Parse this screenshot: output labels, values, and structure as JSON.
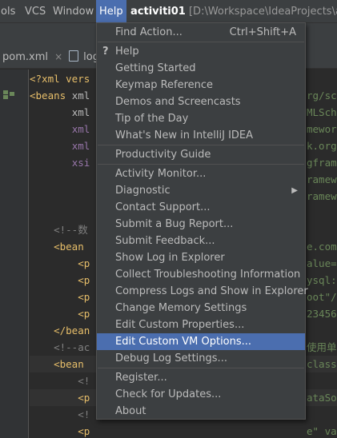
{
  "menubar": {
    "items": [
      {
        "label": "ols"
      },
      {
        "label": "VCS"
      },
      {
        "label": "Window"
      },
      {
        "label": "Help"
      }
    ]
  },
  "titlebar": {
    "project": "activiti01",
    "path": "[D:\\Workspace\\IdeaProjects\\activ"
  },
  "tabs": [
    {
      "label": "pom.xml",
      "close": "×"
    },
    {
      "label": "log"
    }
  ],
  "editor": {
    "lines": [
      {
        "indent": "",
        "parts": [
          [
            "pi",
            "<?xml vers"
          ]
        ]
      },
      {
        "indent": "",
        "parts": [
          [
            "tag",
            "<beans "
          ],
          [
            "attr",
            "xml"
          ]
        ],
        "tail": "rg/sch"
      },
      {
        "indent": "       ",
        "parts": [
          [
            "attr",
            "xml"
          ]
        ],
        "tail": "MLSche"
      },
      {
        "indent": "       ",
        "parts": [
          [
            "attrdim",
            "xml"
          ]
        ],
        "tail": "mework"
      },
      {
        "indent": "       ",
        "parts": [
          [
            "attrdim",
            "xml"
          ]
        ],
        "tail": "k.org/"
      },
      {
        "indent": "       ",
        "parts": [
          [
            "attrdim",
            "xsi"
          ]
        ],
        "tail": "gfram"
      },
      {
        "indent": "",
        "parts": [],
        "tail": "ramewo"
      },
      {
        "indent": "",
        "parts": [],
        "tail": "ramewo"
      },
      {
        "indent": "",
        "parts": []
      },
      {
        "indent": "    ",
        "parts": [
          [
            "cmt",
            "<!--数"
          ]
        ]
      },
      {
        "indent": "    ",
        "parts": [
          [
            "tag",
            "<bean "
          ]
        ],
        "tail": "e.comm"
      },
      {
        "indent": "        ",
        "parts": [
          [
            "tag",
            "<p"
          ]
        ],
        "tail": "alue=\""
      },
      {
        "indent": "        ",
        "parts": [
          [
            "tag",
            "<p"
          ]
        ],
        "tail": "ysql:/"
      },
      {
        "indent": "        ",
        "parts": [
          [
            "tag",
            "<p"
          ]
        ],
        "tail": "oot\"/>"
      },
      {
        "indent": "        ",
        "parts": [
          [
            "tag",
            "<p"
          ]
        ],
        "tail": "23456\""
      },
      {
        "indent": "    ",
        "parts": [
          [
            "tag",
            "</bean"
          ]
        ]
      },
      {
        "indent": "    ",
        "parts": [
          [
            "cmt",
            "<!--ac"
          ]
        ],
        "tail": "使用单"
      },
      {
        "indent": "    ",
        "parts": [
          [
            "tag",
            "<bean "
          ]
        ],
        "tail": "class="
      },
      {
        "indent": "        ",
        "parts": [
          [
            "cmt",
            "<!"
          ]
        ]
      },
      {
        "indent": "        ",
        "parts": [
          [
            "tag",
            "<p"
          ]
        ],
        "tail": "ataSou"
      },
      {
        "indent": "        ",
        "parts": [
          [
            "cmt",
            "<!"
          ]
        ]
      },
      {
        "indent": "        ",
        "parts": [
          [
            "tag",
            "<p"
          ]
        ],
        "tail": "e\" va"
      },
      {
        "indent": "    ",
        "parts": [
          [
            "tag",
            "</bean"
          ]
        ]
      }
    ]
  },
  "help_menu": {
    "items": [
      {
        "label": "Find Action...",
        "shortcut": "Ctrl+Shift+A"
      },
      {
        "sep": true
      },
      {
        "label": "Help",
        "icon": "?"
      },
      {
        "label": "Getting Started"
      },
      {
        "label": "Keymap Reference"
      },
      {
        "label": "Demos and Screencasts"
      },
      {
        "label": "Tip of the Day"
      },
      {
        "label": "What's New in IntelliJ IDEA"
      },
      {
        "sep": true
      },
      {
        "label": "Productivity Guide"
      },
      {
        "sep": true
      },
      {
        "label": "Activity Monitor..."
      },
      {
        "label": "Diagnostic",
        "submenu": true
      },
      {
        "label": "Contact Support..."
      },
      {
        "label": "Submit a Bug Report..."
      },
      {
        "label": "Submit Feedback..."
      },
      {
        "label": "Show Log in Explorer"
      },
      {
        "label": "Collect Troubleshooting Information"
      },
      {
        "label": "Compress Logs and Show in Explorer"
      },
      {
        "label": "Change Memory Settings"
      },
      {
        "label": "Edit Custom Properties..."
      },
      {
        "label": "Edit Custom VM Options...",
        "selected": true
      },
      {
        "label": "Debug Log Settings..."
      },
      {
        "sep": true
      },
      {
        "label": "Register..."
      },
      {
        "label": "Check for Updates..."
      },
      {
        "label": "About"
      }
    ]
  },
  "colors": {
    "selection": "#4b6eaf",
    "menu_bg": "#3c3f41",
    "editor_bg": "#2b2b2b"
  }
}
